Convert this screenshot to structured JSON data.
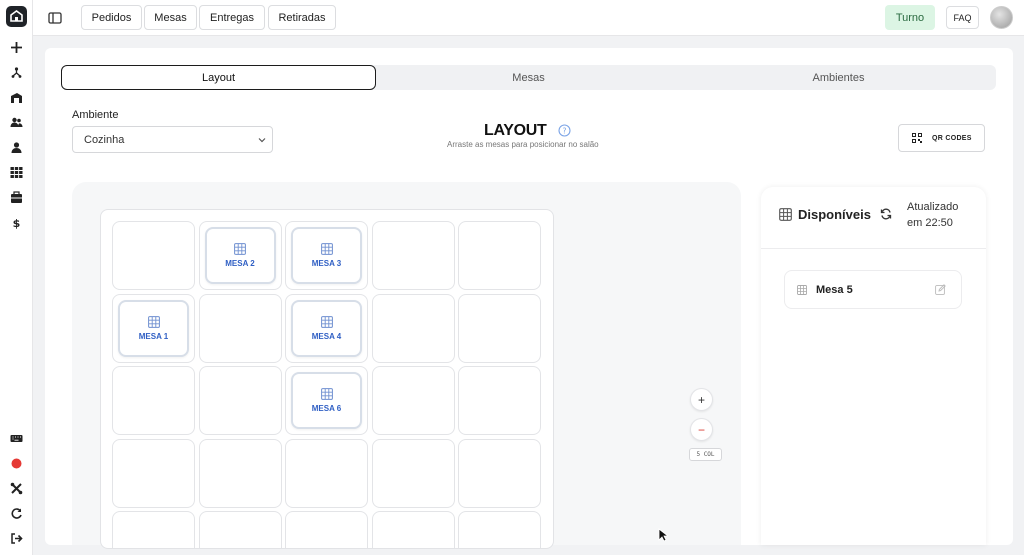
{
  "topnav": {
    "buttons": [
      "Pedidos",
      "Mesas",
      "Entregas",
      "Retiradas"
    ],
    "turno": "Turno",
    "faq": "FAQ"
  },
  "tabs": [
    "Layout",
    "Mesas",
    "Ambientes"
  ],
  "ambiente": {
    "label": "Ambiente",
    "selected": "Cozinha"
  },
  "layout": {
    "title": "LAYOUT",
    "subtitle": "Arraste as mesas para posicionar no salão"
  },
  "qr_button": "QR CODES",
  "grid": {
    "columns": 5,
    "tables": [
      {
        "name": "MESA 2",
        "row": 0,
        "col": 1
      },
      {
        "name": "MESA 3",
        "row": 0,
        "col": 2
      },
      {
        "name": "MESA 1",
        "row": 1,
        "col": 0
      },
      {
        "name": "MESA 4",
        "row": 1,
        "col": 2
      },
      {
        "name": "MESA 6",
        "row": 2,
        "col": 2
      }
    ]
  },
  "zoom": {
    "plus": "+",
    "minus": "−",
    "columns_label": "5 COL"
  },
  "panel": {
    "title": "Disponíveis",
    "updated_line1": "Atualizado",
    "updated_line2": "em 22:50",
    "items": [
      "Mesa 5"
    ]
  },
  "colors": {
    "turno_bg": "#dcf5e4",
    "table_label": "#2f5fc4",
    "minus": "#d9372e",
    "record": "#e53935"
  }
}
